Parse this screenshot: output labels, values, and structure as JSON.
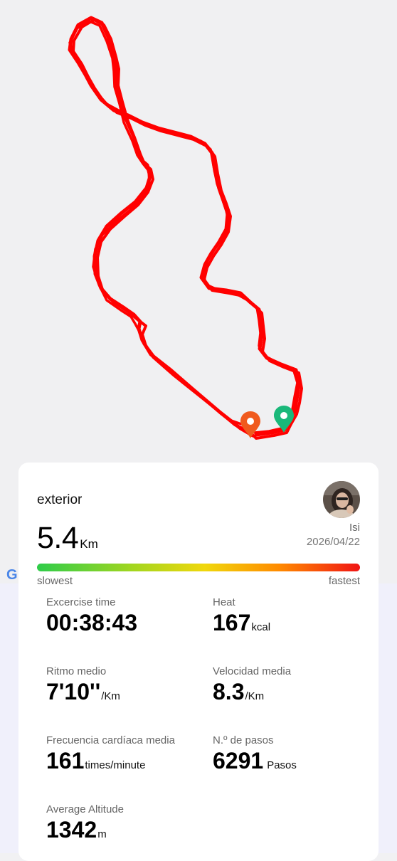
{
  "map": {
    "route_color": "#ff0000",
    "start_marker_color": "#1ab87a",
    "end_marker_color": "#f05a1e",
    "attribution": "G"
  },
  "summary": {
    "activity_type": "exterior",
    "distance_value": "5.4",
    "distance_unit": "Km",
    "user_name": "Isi",
    "date": "2026/04/22"
  },
  "speed_legend": {
    "min_label": "slowest",
    "max_label": "fastest",
    "colors": [
      "#2ecc4a",
      "#f0d70c",
      "#f01414"
    ]
  },
  "stats": [
    {
      "label": "Excercise time",
      "value": "00:38:43",
      "unit": ""
    },
    {
      "label": "Heat",
      "value": "167",
      "unit": "kcal"
    },
    {
      "label": "Ritmo medio",
      "value": "7'10''",
      "unit": "/Km"
    },
    {
      "label": "Velocidad media",
      "value": "8.3",
      "unit": "/Km"
    },
    {
      "label": "Frecuencia cardíaca media",
      "value": "161",
      "unit": "times/minute"
    },
    {
      "label": "N.º de pasos",
      "value": "6291",
      "unit": "Pasos"
    },
    {
      "label": "Average Altitude",
      "value": "1342",
      "unit": "m"
    }
  ]
}
